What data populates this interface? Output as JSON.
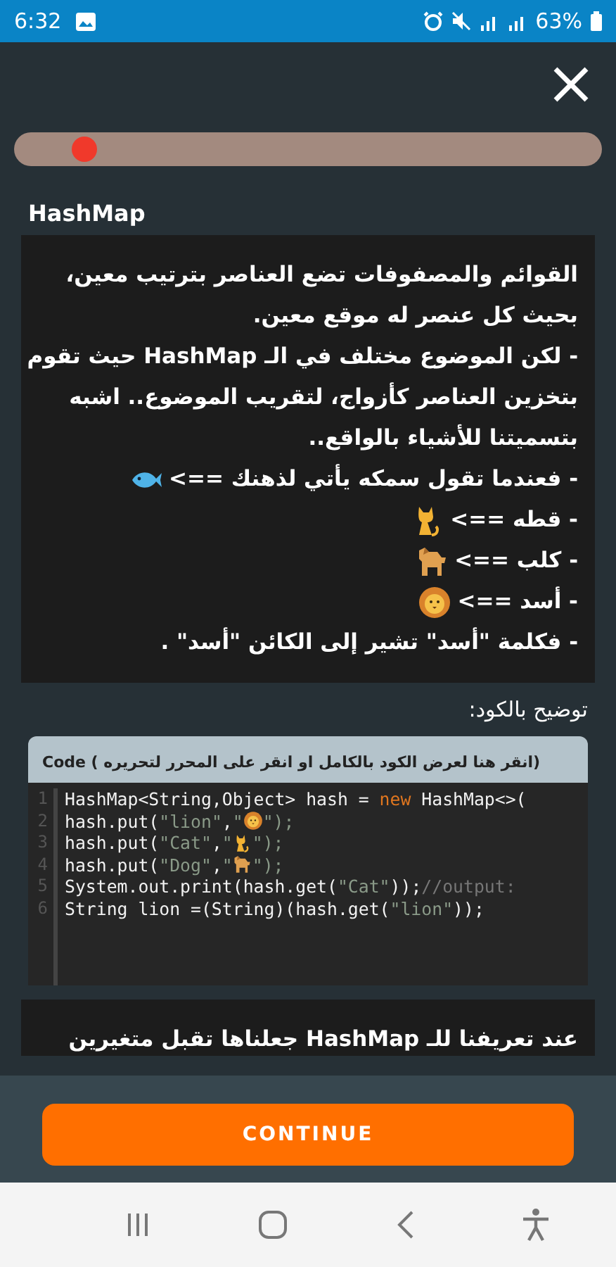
{
  "status_bar": {
    "time": "6:32",
    "battery": "63%"
  },
  "progress": {
    "level": 0.12
  },
  "lesson": {
    "title": "HashMap",
    "lines": [
      {
        "text": "القوائم والمصفوفات تضع العناصر بترتيب معين،"
      },
      {
        "text": "بحيث كل عنصر له موقع معين."
      },
      {
        "text": "- لكن الموضوع مختلف في الـ **HashMap** حيث تقوم"
      },
      {
        "text": "بتخزين العناصر كأزواج، لتقريب الموضوع.. اشبه"
      },
      {
        "text": "بتسميتنا للأشياء بالواقع.."
      },
      {
        "text": "- فعندما تقول سمكه يأتي لذهنك ==>",
        "kind": "fish"
      },
      {
        "text": "- قطه ==>",
        "kind": "cat"
      },
      {
        "text": "- كلب ==>",
        "kind": "dog"
      },
      {
        "text": "- أسد ==>",
        "kind": "lion"
      },
      {
        "text": "- فكلمة \"أسد\" تشير إلى الكائن \"أسد\" ."
      }
    ],
    "code_caption": "توضيح بالكود:",
    "code": {
      "header": "Code ( انقر هنا لعرض الكود بالكامل او انقر على المحرر لتحريره)",
      "lines": [
        {
          "number": "1",
          "text": "HashMap<String,Object> hash = new HashMap<>("
        },
        {
          "number": "2",
          "text": "hash.put(\"lion\",\"",
          "kind": "lion",
          "after": "\");"
        },
        {
          "number": "3",
          "text": "hash.put(\"Cat\",\"",
          "kind": "cat",
          "after": "\");"
        },
        {
          "number": "4",
          "text": "hash.put(\"Dog\",\"",
          "kind": "dog",
          "after": "\");"
        },
        {
          "number": "5",
          "text": "System.out.print(hash.get(\"Cat\"));//output:"
        },
        {
          "number": "6",
          "text": "String lion =(String)(hash.get(\"lion\"));"
        }
      ]
    },
    "next_text": "عند تعريفنا للـ **HashMap** جعلناها تقبل متغيرين"
  },
  "continue_button": "CONTINUE"
}
